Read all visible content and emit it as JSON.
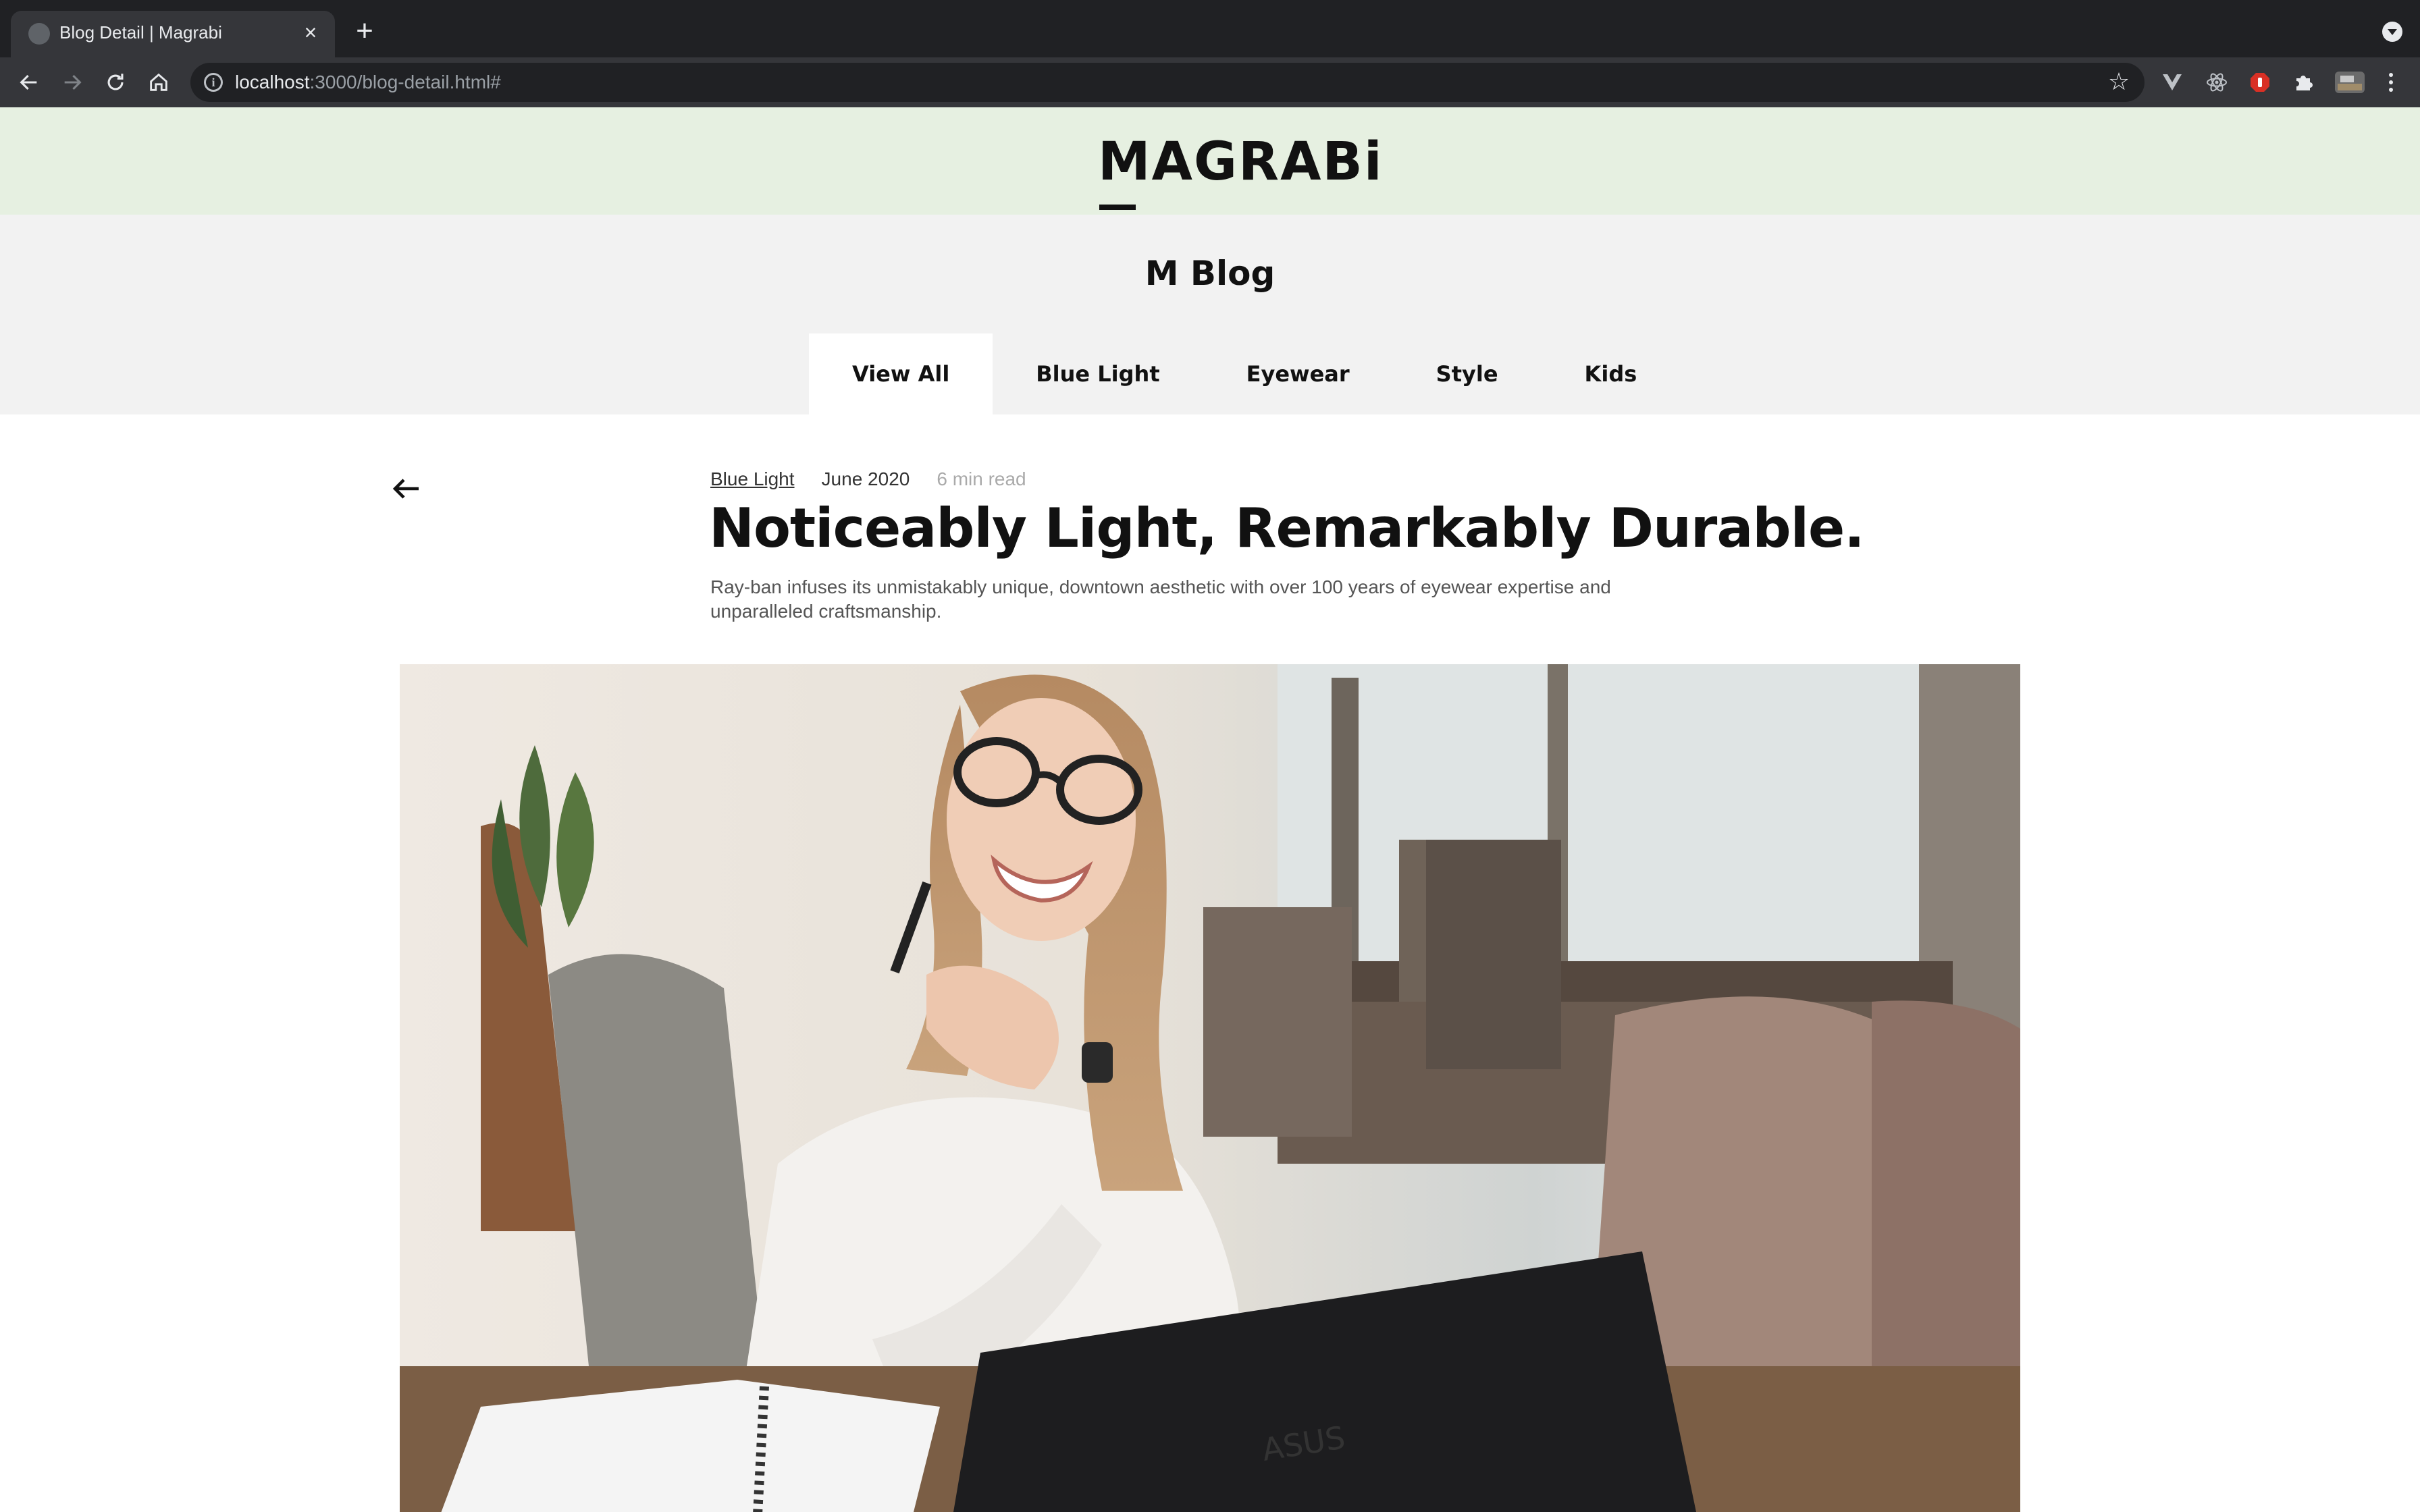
{
  "browser": {
    "tab_title": "Blog Detail | Magrabi",
    "url_host": "localhost",
    "url_path": ":3000/blog-detail.html#"
  },
  "header": {
    "logo": "MAGRABi"
  },
  "blog": {
    "title": "M Blog",
    "tabs": [
      {
        "label": "View All",
        "active": true
      },
      {
        "label": "Blue Light",
        "active": false
      },
      {
        "label": "Eyewear",
        "active": false
      },
      {
        "label": "Style",
        "active": false
      },
      {
        "label": "Kids",
        "active": false
      }
    ]
  },
  "article": {
    "category": "Blue Light",
    "date": "June 2020",
    "read_time": "6 min read",
    "headline": "Noticeably Light, Remarkably Durable.",
    "lede": "Ray-ban infuses its unmistakably unique, downtown aesthetic with over 100 years of eyewear expertise and unparalleled craftsmanship."
  },
  "colors": {
    "header_bg": "#e6f0e1",
    "band_bg": "#f2f2f2",
    "chrome_dark": "#202124"
  },
  "icons": [
    "globe-icon",
    "close-icon",
    "plus-icon",
    "back-icon",
    "forward-icon",
    "reload-icon",
    "home-icon",
    "info-icon",
    "star-icon",
    "puzzle-icon",
    "menu-dots-icon",
    "arrow-left-icon"
  ]
}
